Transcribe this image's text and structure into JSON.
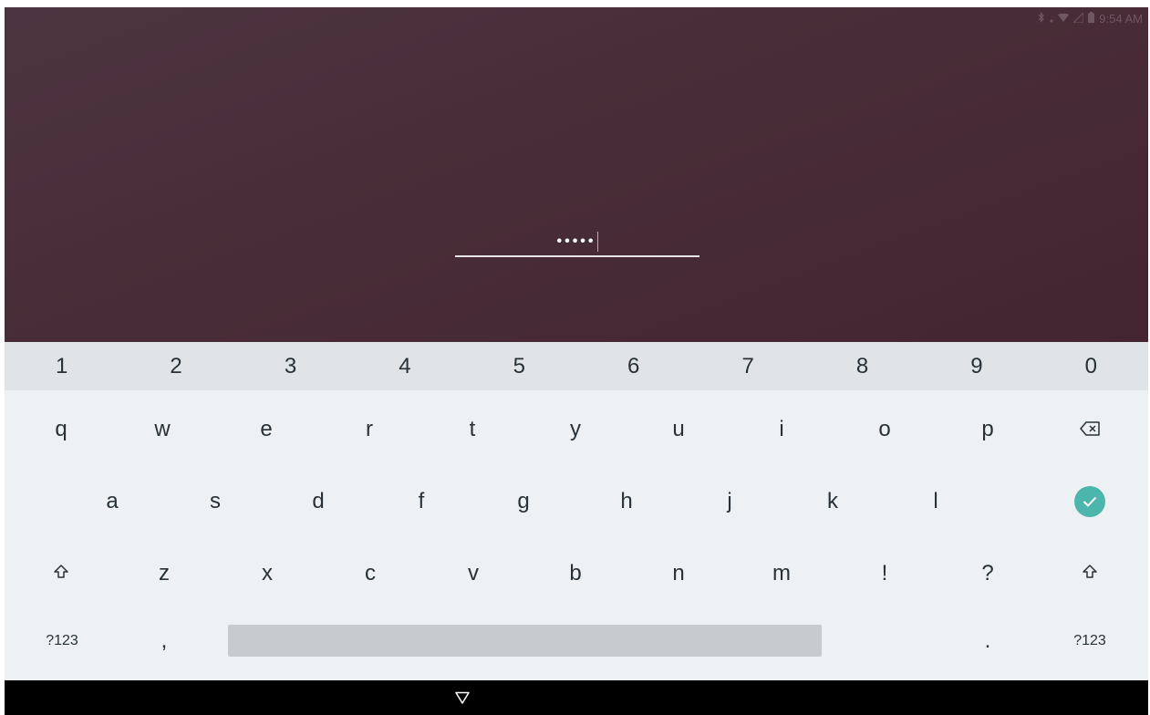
{
  "status_bar": {
    "time": "9:54 AM",
    "icons": [
      "bluetooth-icon",
      "wifi-icon",
      "signal-icon",
      "battery-icon"
    ]
  },
  "password_field": {
    "masked_value": "•••••"
  },
  "keyboard": {
    "number_row": [
      "1",
      "2",
      "3",
      "4",
      "5",
      "6",
      "7",
      "8",
      "9",
      "0"
    ],
    "row1": [
      "q",
      "w",
      "e",
      "r",
      "t",
      "y",
      "u",
      "i",
      "o",
      "p"
    ],
    "row2": [
      "a",
      "s",
      "d",
      "f",
      "g",
      "h",
      "j",
      "k",
      "l"
    ],
    "row3": [
      "z",
      "x",
      "c",
      "v",
      "b",
      "n",
      "m",
      "!",
      "?"
    ],
    "bottom_left_symbols": "?123",
    "comma": ",",
    "period": ".",
    "bottom_right_symbols": "?123",
    "backspace_icon": "backspace-icon",
    "done_icon": "checkmark-icon",
    "shift_icon": "shift-icon",
    "accent_color": "#4db6ac"
  },
  "nav_bar": {
    "back_icon": "back-triangle-icon"
  }
}
